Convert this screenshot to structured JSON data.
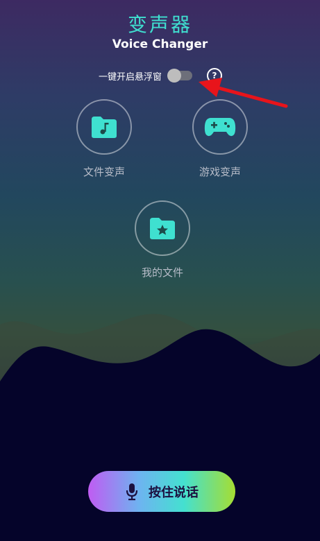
{
  "header": {
    "title_cn": "变声器",
    "title_en": "Voice Changer"
  },
  "floating_window": {
    "label": "一键开启悬浮窗",
    "enabled": false,
    "help_symbol": "?"
  },
  "features": [
    {
      "label": "文件变声",
      "icon": "music-folder-icon"
    },
    {
      "label": "游戏变声",
      "icon": "gamepad-icon"
    },
    {
      "label": "我的文件",
      "icon": "star-folder-icon"
    }
  ],
  "talk_button": {
    "label": "按住说话",
    "icon": "microphone-icon"
  },
  "colors": {
    "accent": "#3fe0d0",
    "arrow": "#e8141b",
    "dark_bg": "#05042a"
  }
}
